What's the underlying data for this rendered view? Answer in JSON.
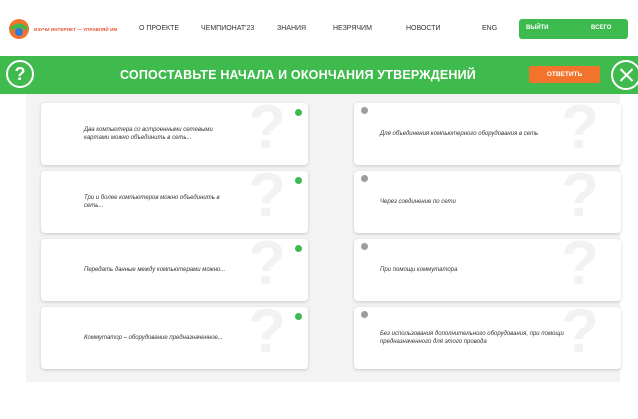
{
  "header": {
    "logo_text": "ИЗУЧИ ИНТЕРНЕТ — УПРАВЛЯЙ ИМ",
    "nav": [
      "О ПРОЕКТЕ",
      "ЧЕМПИОНАТ'23",
      "ЗНАНИЯ",
      "НЕЗРЯЧИМ",
      "НОВОСТИ",
      "ENG"
    ],
    "logout_label": "ВЫЙТИ",
    "all_label": "ВСЕГО"
  },
  "banner": {
    "help_icon": "?",
    "title": "СОПОСТАВЬТЕ НАЧАЛА И ОКОНЧАНИЯ УТВЕРЖДЕНИЙ",
    "answer_label": "ОТВЕТИТЬ",
    "close_icon": "close-icon"
  },
  "colors": {
    "green": "#3fba4c",
    "orange": "#f2742c",
    "dot_selected": "#3dbb4f",
    "dot_idle": "#9d9d9d"
  },
  "game": {
    "watermark": "?",
    "left_cards": [
      "Два компьютера со встроенными сетевыми картами можно объединить в сеть...",
      "Три и более компьютеров можно объединить в сеть...",
      "Передать данные между компьютерами можно...",
      "Коммутатор – оборудование предназначенное..."
    ],
    "right_cards": [
      "Для объединения компьютерного оборудования в сеть",
      "Через соединение по сети",
      "При помощи коммутатора",
      "Без использования дополнительного оборудования, при помощи предназначенного для этого провода"
    ]
  }
}
